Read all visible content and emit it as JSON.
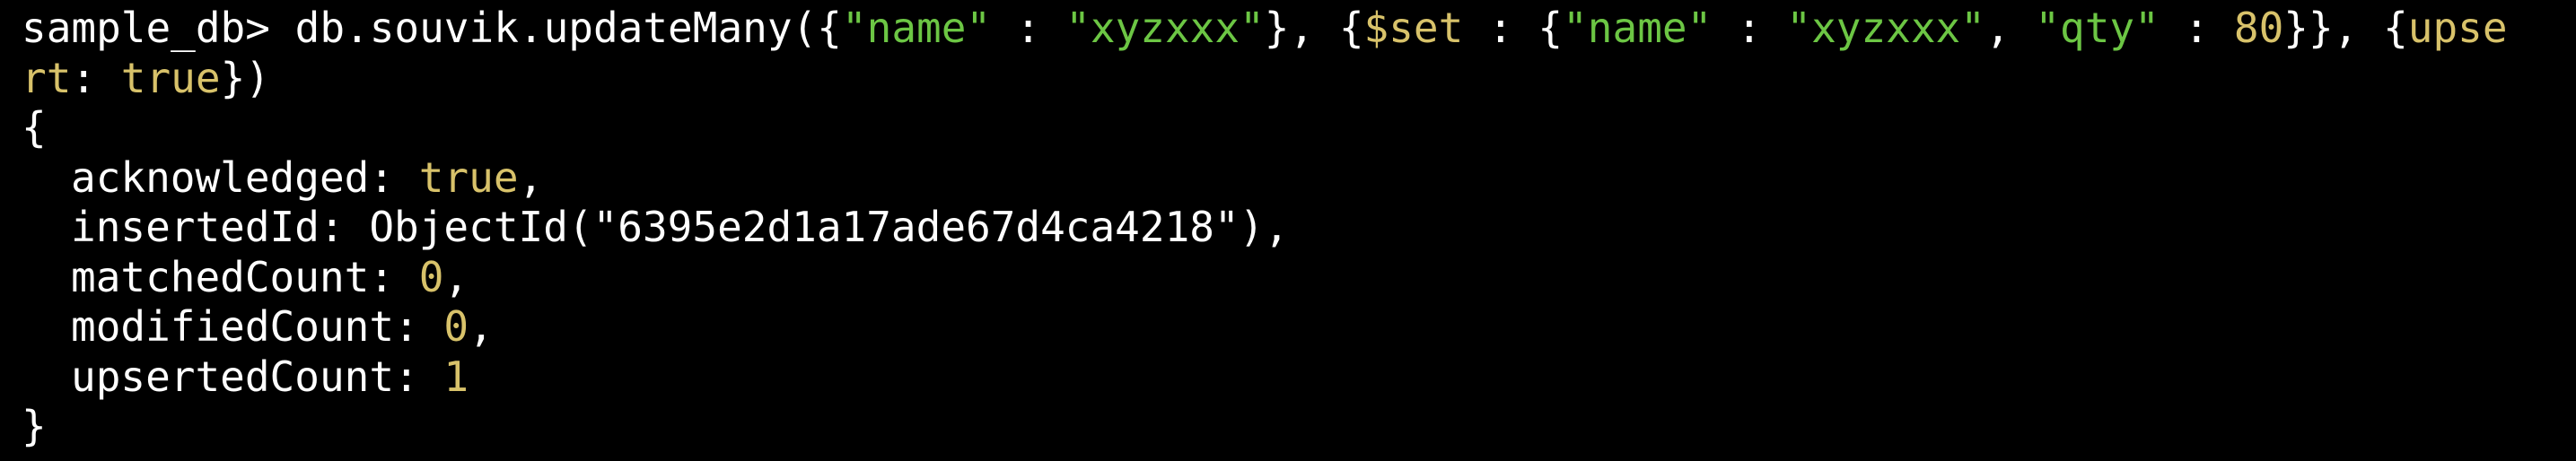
{
  "theme": {
    "background": "#000000",
    "text": "#ffffff",
    "string_green": "#6cc644",
    "keyword_yellow": "#d8c26a"
  },
  "command": {
    "prompt": "sample_db> ",
    "call": "db.souvik.updateMany(",
    "brace_open_1": "{",
    "filter_key": "\"name\"",
    "sep_1": " : ",
    "filter_value": "\"xyzxxx\"",
    "brace_close_1": "}, {",
    "set_op": "$set",
    "sep_2": " : {",
    "set_key_name": "\"name\"",
    "sep_3": " : ",
    "set_value_name": "\"xyzxxx\"",
    "sep_4": ", ",
    "set_key_qty": "\"qty\"",
    "sep_5": " : ",
    "set_value_qty": "80",
    "sep_6": "}}, {",
    "upsert_part1": "upse",
    "upsert_part2": "rt",
    "sep_7": ": ",
    "upsert_value": "true",
    "end": "})"
  },
  "result": {
    "open": "{",
    "acknowledged_label": "acknowledged: ",
    "acknowledged_value": "true",
    "acknowledged_comma": ",",
    "insertedId_label": "insertedId: ",
    "insertedId_value": "ObjectId(\"6395e2d1a17ade67d4ca4218\"),",
    "matchedCount_label": "matchedCount: ",
    "matchedCount_value": "0",
    "matchedCount_comma": ",",
    "modifiedCount_label": "modifiedCount: ",
    "modifiedCount_value": "0",
    "modifiedCount_comma": ",",
    "upsertedCount_label": "upsertedCount: ",
    "upsertedCount_value": "1",
    "close": "}"
  }
}
